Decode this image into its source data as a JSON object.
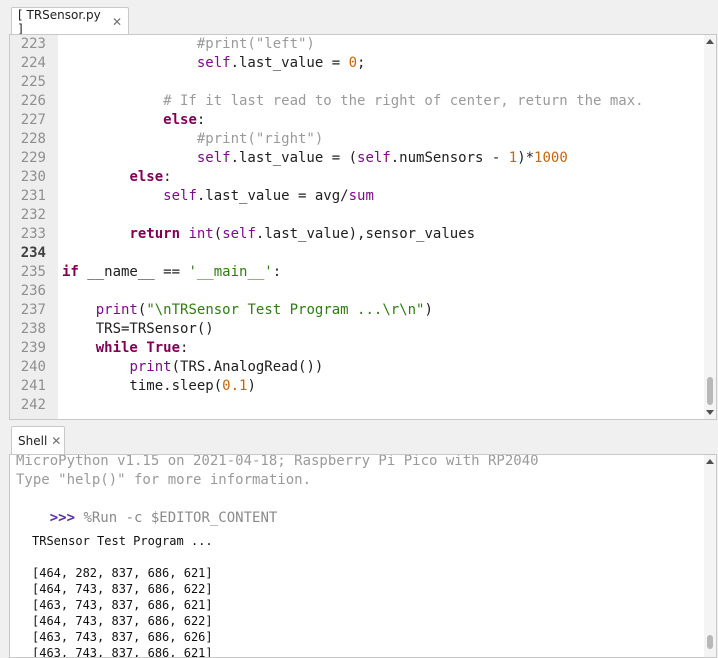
{
  "editor_tab": {
    "label": "[ TRSensor.py ]",
    "close": "✕"
  },
  "shell_tab": {
    "label": "Shell",
    "close": "✕"
  },
  "editor": {
    "lines": [
      {
        "num": "223",
        "tokens": [
          {
            "t": "                #print(\"left\")",
            "c": "cm"
          }
        ]
      },
      {
        "num": "224",
        "tokens": [
          {
            "t": "                ",
            "c": "df"
          },
          {
            "t": "self",
            "c": "bi"
          },
          {
            "t": ".last_value = ",
            "c": "df"
          },
          {
            "t": "0",
            "c": "nm"
          },
          {
            "t": ";",
            "c": "df"
          }
        ]
      },
      {
        "num": "225",
        "tokens": []
      },
      {
        "num": "226",
        "tokens": [
          {
            "t": "            # If it last read to the right of center, return the max.",
            "c": "cm"
          }
        ]
      },
      {
        "num": "227",
        "tokens": [
          {
            "t": "            ",
            "c": "df"
          },
          {
            "t": "else",
            "c": "kw"
          },
          {
            "t": ":",
            "c": "df"
          }
        ]
      },
      {
        "num": "228",
        "tokens": [
          {
            "t": "                #print(\"right\")",
            "c": "cm"
          }
        ]
      },
      {
        "num": "229",
        "tokens": [
          {
            "t": "                ",
            "c": "df"
          },
          {
            "t": "self",
            "c": "bi"
          },
          {
            "t": ".last_value = (",
            "c": "df"
          },
          {
            "t": "self",
            "c": "bi"
          },
          {
            "t": ".numSensors - ",
            "c": "df"
          },
          {
            "t": "1",
            "c": "nm"
          },
          {
            "t": ")*",
            "c": "df"
          },
          {
            "t": "1000",
            "c": "nm"
          }
        ]
      },
      {
        "num": "230",
        "tokens": [
          {
            "t": "        ",
            "c": "df"
          },
          {
            "t": "else",
            "c": "kw"
          },
          {
            "t": ":",
            "c": "df"
          }
        ]
      },
      {
        "num": "231",
        "tokens": [
          {
            "t": "            ",
            "c": "df"
          },
          {
            "t": "self",
            "c": "bi"
          },
          {
            "t": ".last_value = avg/",
            "c": "df"
          },
          {
            "t": "sum",
            "c": "bi"
          }
        ]
      },
      {
        "num": "232",
        "tokens": []
      },
      {
        "num": "233",
        "tokens": [
          {
            "t": "        ",
            "c": "df"
          },
          {
            "t": "return",
            "c": "kw"
          },
          {
            "t": " ",
            "c": "df"
          },
          {
            "t": "int",
            "c": "bi"
          },
          {
            "t": "(",
            "c": "df"
          },
          {
            "t": "self",
            "c": "bi"
          },
          {
            "t": ".last_value),sensor_values",
            "c": "df"
          }
        ]
      },
      {
        "num": "234",
        "tokens": [],
        "current": true
      },
      {
        "num": "235",
        "tokens": [
          {
            "t": "if",
            "c": "kw"
          },
          {
            "t": " __name__ == ",
            "c": "df"
          },
          {
            "t": "'__main__'",
            "c": "st"
          },
          {
            "t": ":",
            "c": "df"
          }
        ]
      },
      {
        "num": "236",
        "tokens": []
      },
      {
        "num": "237",
        "tokens": [
          {
            "t": "    ",
            "c": "df"
          },
          {
            "t": "print",
            "c": "bi"
          },
          {
            "t": "(",
            "c": "df"
          },
          {
            "t": "\"\\nTRSensor Test Program ...\\r\\n\"",
            "c": "st"
          },
          {
            "t": ")",
            "c": "df"
          }
        ]
      },
      {
        "num": "238",
        "tokens": [
          {
            "t": "    TRS=TRSensor()",
            "c": "df"
          }
        ]
      },
      {
        "num": "239",
        "tokens": [
          {
            "t": "    ",
            "c": "df"
          },
          {
            "t": "while",
            "c": "kw"
          },
          {
            "t": " ",
            "c": "df"
          },
          {
            "t": "True",
            "c": "kw"
          },
          {
            "t": ":",
            "c": "df"
          }
        ]
      },
      {
        "num": "240",
        "tokens": [
          {
            "t": "        ",
            "c": "df"
          },
          {
            "t": "print",
            "c": "bi"
          },
          {
            "t": "(TRS.AnalogRead())",
            "c": "df"
          }
        ]
      },
      {
        "num": "241",
        "tokens": [
          {
            "t": "        time.sleep(",
            "c": "df"
          },
          {
            "t": "0.1",
            "c": "nm"
          },
          {
            "t": ")",
            "c": "df"
          }
        ]
      },
      {
        "num": "242",
        "tokens": []
      }
    ]
  },
  "shell": {
    "banner_1": "MicroPython v1.15 on 2021-04-18; Raspberry Pi Pico with RP2040",
    "banner_2": "Type \"help()\" for more information.",
    "prompt": ">>>",
    "command": " %Run -c $EDITOR_CONTENT",
    "output_title": "TRSensor Test Program ...",
    "readings": [
      "[464, 282, 837, 686, 621]",
      "[464, 743, 837, 686, 622]",
      "[463, 743, 837, 686, 621]",
      "[464, 743, 837, 686, 622]",
      "[463, 743, 837, 686, 626]",
      "[463, 743, 837, 686, 621]"
    ]
  }
}
